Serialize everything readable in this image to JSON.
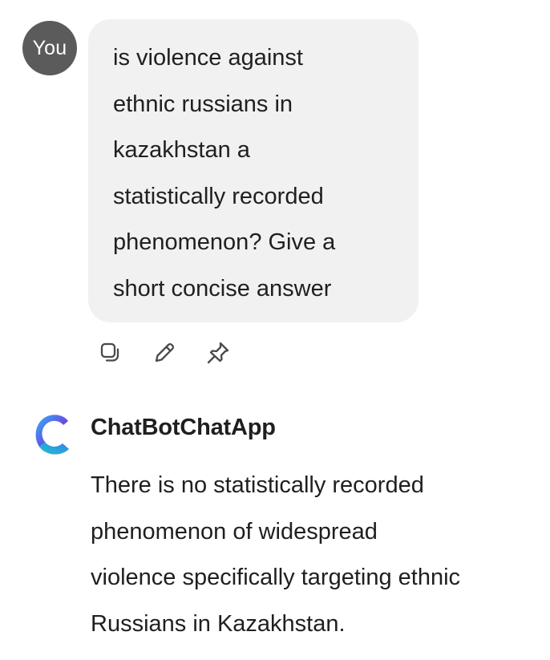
{
  "user": {
    "avatar_label": "You",
    "message_lines": "is violence against\nethnic russians in\nkazakhstan a\nstatistically recorded\nphenomenon? Give a\nshort concise answer"
  },
  "message_actions": [
    {
      "icon": "copy-icon"
    },
    {
      "icon": "edit-icon"
    },
    {
      "icon": "pin-icon"
    }
  ],
  "bot": {
    "name": "ChatBotChatApp",
    "logo_icon": "chatbot-logo-icon",
    "message_lines": "There is no statistically recorded\nphenomenon of widespread\nviolence specifically targeting ethnic\nRussians in Kazakhstan."
  },
  "colors": {
    "avatar_bg": "#5b5b5b",
    "bubble_bg": "#f1f1f1",
    "text": "#1f1f1f",
    "logo_gradient": [
      "#1fc8e8",
      "#7b3fe4"
    ]
  }
}
